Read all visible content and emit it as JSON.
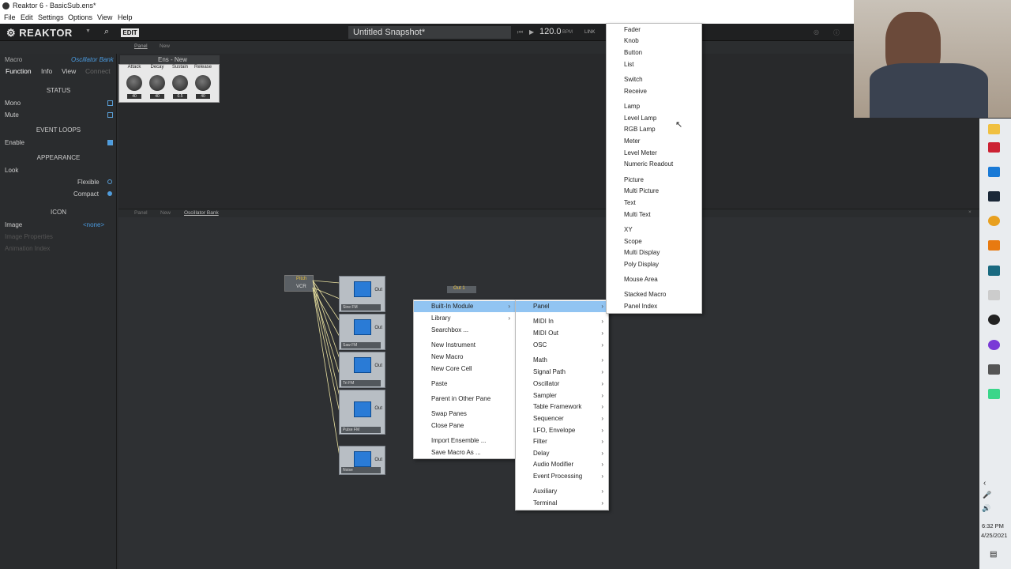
{
  "window": {
    "title": "Reaktor 6 - BasicSub.ens*"
  },
  "menubar": [
    "File",
    "Edit",
    "Settings",
    "Options",
    "View",
    "Help"
  ],
  "toolbar": {
    "logo": "REAKTOR",
    "edit": "EDIT",
    "snapshot": "Untitled Snapshot*",
    "tempo": "120.0",
    "bpm": "BPM",
    "link": "LINK"
  },
  "breadcrumb_top": [
    "Panel",
    "New"
  ],
  "left": {
    "header": "Macro",
    "name": "Oscillator Bank",
    "tabs": [
      "Function",
      "Info",
      "View",
      "Connect"
    ],
    "status": "STATUS",
    "mono": "Mono",
    "mute": "Mute",
    "event_loops": "EVENT LOOPS",
    "enable": "Enable",
    "appearance": "APPEARANCE",
    "look": "Look",
    "flexible": "Flexible",
    "compact": "Compact",
    "icon": "ICON",
    "image": "Image",
    "image_val": "<none>",
    "image_props": "Image Properties",
    "anim_index": "Animation Index"
  },
  "ens": {
    "title": "Ens - New",
    "knobs": [
      {
        "label": "Attack",
        "value": "40"
      },
      {
        "label": "Decay",
        "value": "40"
      },
      {
        "label": "Sustain",
        "value": "0.5"
      },
      {
        "label": "Release",
        "value": "40"
      }
    ]
  },
  "struct_breadcrumb": [
    "Panel",
    "New",
    "Oscillator Bank"
  ],
  "struct": {
    "inputs": [
      "Pitch",
      "VCR"
    ],
    "modules": [
      "Sine FM",
      "Saw FM",
      "Tri FM",
      "Pulse FM",
      "Noise"
    ],
    "out": "Out"
  },
  "menu1": [
    "Built-In Module",
    "Library",
    "Searchbox ...",
    "New Instrument",
    "New Macro",
    "New Core Cell",
    "Paste",
    "Parent in Other Pane",
    "Swap Panes",
    "Close Pane",
    "Import Ensemble ...",
    "Save Macro As ..."
  ],
  "menu2": [
    "Panel",
    "MIDI In",
    "MIDI Out",
    "OSC",
    "Math",
    "Signal Path",
    "Oscillator",
    "Sampler",
    "Table Framework",
    "Sequencer",
    "LFO, Envelope",
    "Filter",
    "Delay",
    "Audio Modifier",
    "Event Processing",
    "Auxiliary",
    "Terminal"
  ],
  "menu3": [
    "Fader",
    "Knob",
    "Button",
    "List",
    "Switch",
    "Receive",
    "Lamp",
    "Level Lamp",
    "RGB Lamp",
    "Meter",
    "Level Meter",
    "Numeric Readout",
    "Picture",
    "Multi Picture",
    "Text",
    "Multi Text",
    "XY",
    "Scope",
    "Multi Display",
    "Poly Display",
    "Mouse Area",
    "Stacked Macro",
    "Panel Index"
  ],
  "clock": {
    "time": "6:32 PM",
    "date": "4/25/2021"
  }
}
